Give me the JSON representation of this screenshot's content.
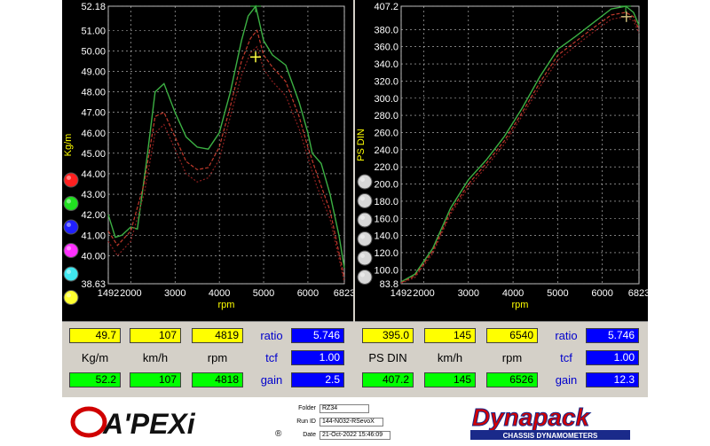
{
  "charts": {
    "left": {
      "ylabel": "Kg/m",
      "xlabel": "rpm",
      "ymin": 38.63,
      "ymax": 52.18,
      "xmin": 1492,
      "xmax": 6823,
      "yticks": [
        "52.18",
        "51.00",
        "50.00",
        "49.00",
        "48.00",
        "47.00",
        "46.00",
        "45.00",
        "44.00",
        "43.00",
        "42.00",
        "41.00",
        "40.00",
        "38.63"
      ],
      "xticks": [
        "1492",
        "2000",
        "3000",
        "4000",
        "5000",
        "6000",
        "6823"
      ]
    },
    "right": {
      "ylabel": "PS DIN",
      "xlabel": "rpm",
      "ymin": 83.8,
      "ymax": 407.2,
      "xmin": 1492,
      "xmax": 6823,
      "yticks": [
        "407.2",
        "380.0",
        "360.0",
        "340.0",
        "320.0",
        "300.0",
        "280.0",
        "260.0",
        "240.0",
        "220.0",
        "200.0",
        "180.0",
        "160.0",
        "140.0",
        "120.0",
        "100.0",
        "83.8"
      ],
      "xticks": [
        "1492",
        "2000",
        "3000",
        "4000",
        "5000",
        "6000",
        "6823"
      ]
    }
  },
  "chart_data": [
    {
      "type": "line",
      "ylabel": "Kg/m",
      "xlabel": "rpm",
      "ylim": [
        38.63,
        52.18
      ],
      "xlim": [
        1492,
        6823
      ],
      "series": [
        {
          "color": "#3cb043",
          "x": [
            1492,
            1650,
            1800,
            2000,
            2150,
            2350,
            2550,
            2750,
            3000,
            3250,
            3500,
            3750,
            4000,
            4250,
            4500,
            4650,
            4820,
            5000,
            5200,
            5500,
            5800,
            6000,
            6100,
            6300,
            6500,
            6700,
            6823
          ],
          "values": [
            42.0,
            40.9,
            41.0,
            41.4,
            41.3,
            44.5,
            48.0,
            48.4,
            47.0,
            45.8,
            45.3,
            45.2,
            46.0,
            48.0,
            50.5,
            51.7,
            52.18,
            50.5,
            49.8,
            49.3,
            47.5,
            46.0,
            45.0,
            44.5,
            43.0,
            41.0,
            39.4
          ]
        },
        {
          "color": "#c0392b",
          "x": [
            1492,
            1700,
            2000,
            2300,
            2550,
            2750,
            3000,
            3250,
            3500,
            3750,
            4000,
            4250,
            4500,
            4700,
            4850,
            5000,
            5200,
            5500,
            5800,
            6000,
            6200,
            6500,
            6823
          ],
          "values": [
            41.2,
            40.5,
            41.2,
            43.5,
            46.8,
            47.0,
            45.8,
            44.6,
            44.2,
            44.3,
            45.3,
            47.3,
            49.5,
            50.6,
            51.0,
            49.8,
            49.2,
            48.5,
            46.8,
            45.3,
            44.0,
            42.2,
            38.9
          ]
        },
        {
          "color": "#8b1f1f",
          "x": [
            1492,
            1700,
            2000,
            2300,
            2550,
            2750,
            3000,
            3250,
            3500,
            3750,
            4000,
            4250,
            4500,
            4700,
            4850,
            5000,
            5200,
            5500,
            5800,
            6000,
            6200,
            6500,
            6823
          ],
          "values": [
            40.7,
            40.0,
            40.7,
            43.0,
            46.0,
            46.4,
            45.2,
            44.0,
            43.6,
            43.8,
            44.7,
            46.8,
            48.8,
            49.9,
            50.2,
            49.1,
            48.5,
            47.8,
            46.2,
            44.8,
            43.4,
            41.8,
            38.7
          ]
        }
      ]
    },
    {
      "type": "line",
      "ylabel": "PS DIN",
      "xlabel": "rpm",
      "ylim": [
        83.8,
        407.2
      ],
      "xlim": [
        1492,
        6823
      ],
      "series": [
        {
          "color": "#3cb043",
          "x": [
            1492,
            1800,
            2200,
            2600,
            3000,
            3400,
            3800,
            4200,
            4600,
            5000,
            5400,
            5800,
            6200,
            6526,
            6700,
            6823
          ],
          "values": [
            86,
            95,
            125,
            172,
            205,
            228,
            255,
            288,
            325,
            357,
            372,
            388,
            404,
            407.2,
            400,
            385
          ]
        },
        {
          "color": "#c0392b",
          "x": [
            1492,
            1800,
            2200,
            2600,
            3000,
            3400,
            3800,
            4200,
            4600,
            5000,
            5400,
            5800,
            6200,
            6526,
            6700,
            6823
          ],
          "values": [
            85,
            93,
            122,
            168,
            200,
            224,
            250,
            283,
            318,
            350,
            366,
            382,
            397,
            400,
            395,
            380
          ]
        },
        {
          "color": "#8b1f1f",
          "x": [
            1492,
            1800,
            2200,
            2600,
            3000,
            3400,
            3800,
            4200,
            4600,
            5000,
            5400,
            5800,
            6200,
            6526,
            6700,
            6823
          ],
          "values": [
            84.5,
            91,
            119,
            165,
            196,
            220,
            246,
            279,
            313,
            344,
            361,
            377,
            392,
            395,
            390,
            376
          ]
        }
      ]
    }
  ],
  "sidebar_left": {
    "buttons": [
      {
        "name": "red-button",
        "color": "#ff2020"
      },
      {
        "name": "green-button",
        "color": "#20e020"
      },
      {
        "name": "blue-button",
        "color": "#2020ff"
      },
      {
        "name": "magenta-button",
        "color": "#ff30ff"
      },
      {
        "name": "cyan-button",
        "color": "#40e8f0"
      },
      {
        "name": "yellow-button",
        "color": "#ffff30"
      }
    ]
  },
  "sidebar_right": {
    "buttons": [
      {
        "name": "grey-button-1",
        "color": "#d8d8d8"
      },
      {
        "name": "grey-button-2",
        "color": "#d8d8d8"
      },
      {
        "name": "grey-button-3",
        "color": "#d8d8d8"
      },
      {
        "name": "grey-button-4",
        "color": "#d8d8d8"
      },
      {
        "name": "grey-button-5",
        "color": "#d8d8d8"
      },
      {
        "name": "grey-button-6",
        "color": "#d8d8d8"
      }
    ]
  },
  "panel_left": {
    "cursor": {
      "torque": "49.7",
      "speed": "107",
      "rpm": "4819"
    },
    "units": {
      "torque": "Kg/m",
      "speed": "km/h",
      "rpm": "rpm"
    },
    "peak": {
      "torque": "52.2",
      "speed": "107",
      "rpm": "4818"
    },
    "labels": {
      "ratio": "ratio",
      "tcf": "tcf",
      "gain": "gain"
    },
    "values": {
      "ratio": "5.746",
      "tcf": "1.00",
      "gain": "2.5"
    }
  },
  "panel_right": {
    "cursor": {
      "power": "395.0",
      "speed": "145",
      "rpm": "6540"
    },
    "units": {
      "power": "PS DIN",
      "speed": "km/h",
      "rpm": "rpm"
    },
    "peak": {
      "power": "407.2",
      "speed": "145",
      "rpm": "6526"
    },
    "labels": {
      "ratio": "ratio",
      "tcf": "tcf",
      "gain": "gain"
    },
    "values": {
      "ratio": "5.746",
      "tcf": "1.00",
      "gain": "12.3"
    }
  },
  "footer": {
    "apexi_logo": "A'PEXi",
    "registered": "®",
    "folder_label": "Folder",
    "folder_value": "RZ34",
    "runid_label": "Run ID",
    "runid_value": "144-N032-RSevoX",
    "date_label": "Date",
    "date_value": "21-Oct-2022  15:46:09",
    "dynapack_logo": "Dynapack",
    "dynapack_sub": "CHASSIS DYNAMOMETERS"
  }
}
